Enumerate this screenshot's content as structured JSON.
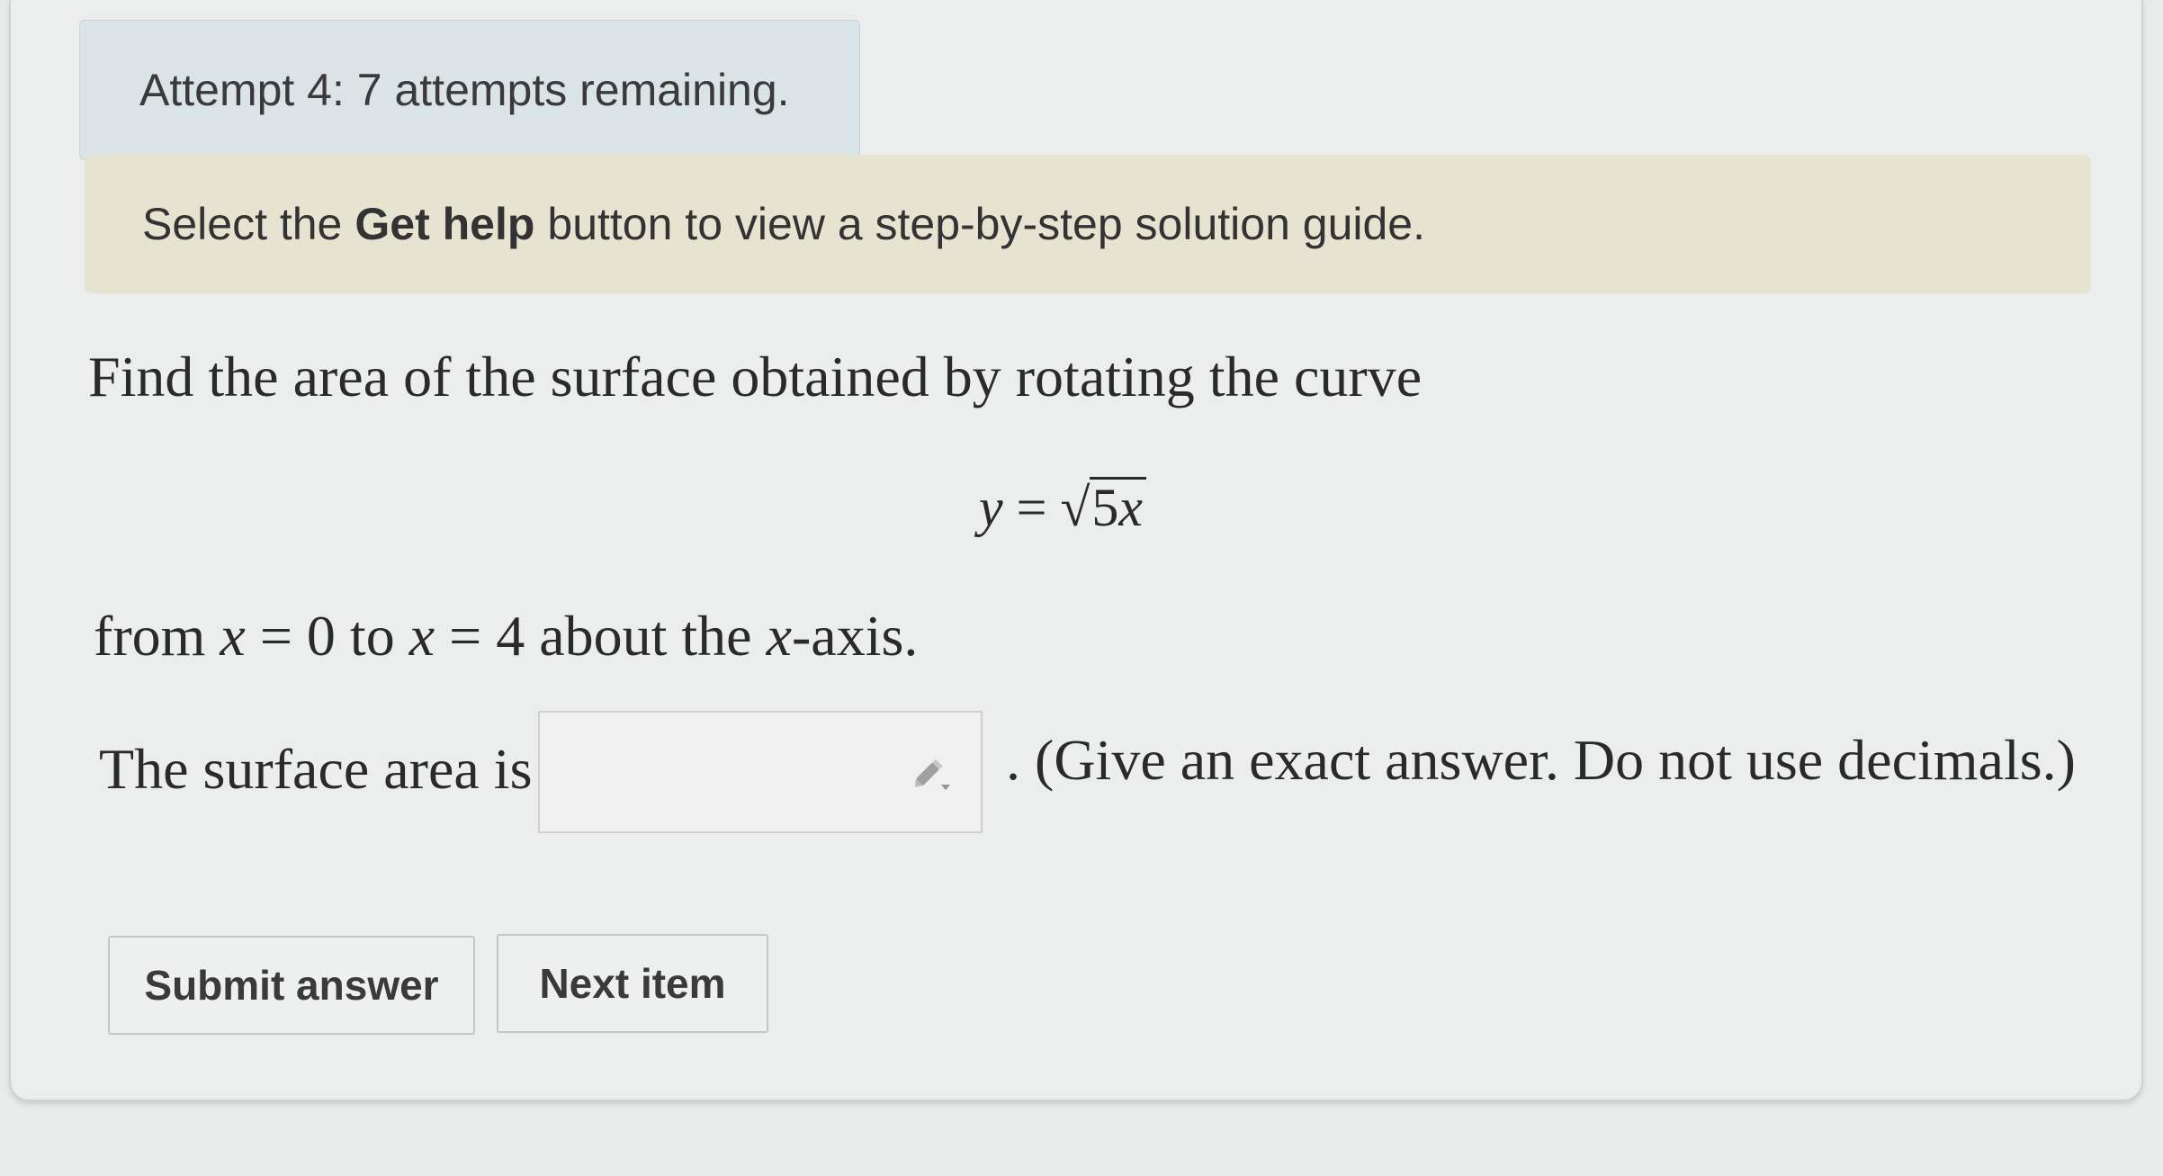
{
  "attempt_banner": {
    "text": "Attempt 4: 7 attempts remaining."
  },
  "help_banner": {
    "prefix": "Select the",
    "bold": "Get help",
    "suffix": "button to view a step-by-step solution guide."
  },
  "question": {
    "prompt": "Find the area of the surface obtained by rotating the curve",
    "equation": {
      "lhs": "y",
      "eq": "=",
      "sqrt_symbol": "√",
      "radicand_coef": "5",
      "radicand_var": "x"
    },
    "range": {
      "from_word": "from",
      "var1": "x",
      "eq1": "=",
      "val1": "0",
      "to_word": "to",
      "var2": "x",
      "eq2": "=",
      "val2": "4",
      "about_text": "about the",
      "axis_var": "x",
      "axis_suffix": "-axis."
    },
    "answer_label": "The surface area is",
    "answer_value": "",
    "answer_hint": ". (Give an exact answer. Do not use decimals.)"
  },
  "buttons": {
    "submit": "Submit answer",
    "next": "Next item"
  },
  "icons": {
    "answer_input": "pencil-icon"
  }
}
